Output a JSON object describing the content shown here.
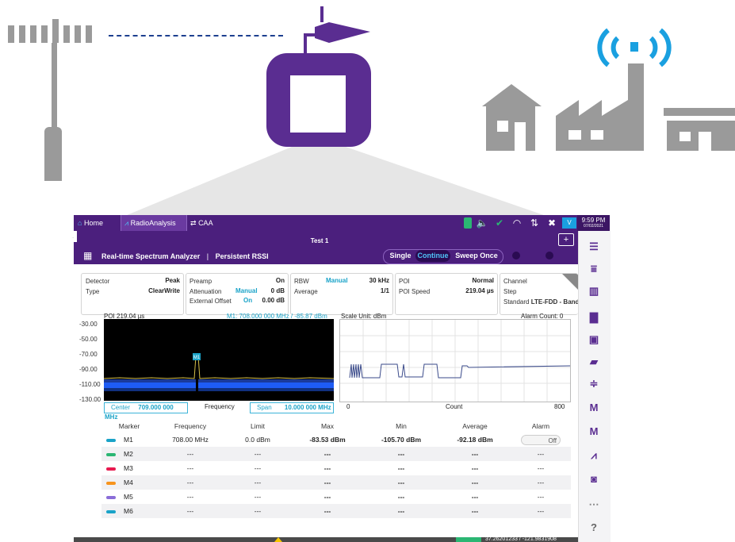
{
  "app": {
    "tabs": [
      {
        "label": "Home",
        "icon": "home-icon"
      },
      {
        "label": "RadioAnalysis",
        "icon": "pulse-icon"
      },
      {
        "label": "CAA",
        "icon": "swap-icon"
      }
    ],
    "time": "9:59 PM",
    "date": "07/02/2021",
    "test_title": "Test 1",
    "add_tab": "+",
    "mode_title": "Real-time Spectrum Analyzer",
    "mode_separator": "|",
    "mode_sub": "Persistent RSSI",
    "sweep_single": "Single",
    "sweep_continue": "Continue",
    "sweep_once": "Sweep Once"
  },
  "params": {
    "detector_label": "Detector",
    "detector_value": "Peak",
    "type_label": "Type",
    "type_value": "ClearWrite",
    "preamp_label": "Preamp",
    "preamp_value": "On",
    "atten_label": "Attenuation",
    "atten_mode": "Manual",
    "atten_value": "0 dB",
    "extoff_label": "External Offset",
    "extoff_mode": "On",
    "extoff_value": "0.00 dB",
    "rbw_label": "RBW",
    "rbw_mode": "Manual",
    "rbw_value": "30 kHz",
    "avg_label": "Average",
    "avg_value": "1/1",
    "poi_label": "POI",
    "poi_value": "Normal",
    "poispeed_label": "POI Speed",
    "poispeed_value": "219.04 µs",
    "channel_label": "Channel",
    "step_label": "Step",
    "standard_label": "Standard",
    "standard_value": "LTE-FDD - Band"
  },
  "plot": {
    "poi_readout": "POI 219.04 µs",
    "marker_readout": "M1: 708.000 000 MHz / -85.87 dBm",
    "scale_unit": "Scale Unit: dBm",
    "alarm_count": "Alarm Count: 0",
    "y_ticks": [
      "-30.00",
      "-50.00",
      "-70.00",
      "-90.00",
      "-110.00",
      "-130.00"
    ],
    "center_label": "Center",
    "center_value": "709.000 000 MHz",
    "freq_label": "Frequency",
    "span_label": "Span",
    "span_value": "10.000 000 MHz",
    "count_min": "0",
    "count_label": "Count",
    "count_max": "800",
    "marker_tag": "M1"
  },
  "table": {
    "headers": [
      "Marker",
      "Frequency",
      "Limit",
      "Max",
      "Min",
      "Average",
      "Alarm"
    ],
    "rows": [
      {
        "marker": "M1",
        "color": "#1aa3c8",
        "frequency": "708.00 MHz",
        "limit": "0.0 dBm",
        "max": "-83.53 dBm",
        "min": "-105.70 dBm",
        "average": "-92.18 dBm",
        "alarm": "Off"
      },
      {
        "marker": "M2",
        "color": "#2bb673",
        "frequency": "---",
        "limit": "---",
        "max": "---",
        "min": "---",
        "average": "---",
        "alarm": "---"
      },
      {
        "marker": "M3",
        "color": "#e8194f",
        "frequency": "---",
        "limit": "---",
        "max": "---",
        "min": "---",
        "average": "---",
        "alarm": "---"
      },
      {
        "marker": "M4",
        "color": "#f7941d",
        "frequency": "---",
        "limit": "---",
        "max": "---",
        "min": "---",
        "average": "---",
        "alarm": "---"
      },
      {
        "marker": "M5",
        "color": "#8a6dd8",
        "frequency": "---",
        "limit": "---",
        "max": "---",
        "min": "---",
        "average": "---",
        "alarm": "---"
      },
      {
        "marker": "M6",
        "color": "#1aa3c8",
        "frequency": "---",
        "limit": "---",
        "max": "---",
        "min": "---",
        "average": "---",
        "alarm": "---"
      }
    ]
  },
  "statusbar": {
    "coordinates": "37.26201233 / -121.9831908"
  },
  "colors": {
    "brand": "#4b1f7d",
    "accent": "#1aa3c8",
    "wifi_signal": "#1aa0e0"
  }
}
